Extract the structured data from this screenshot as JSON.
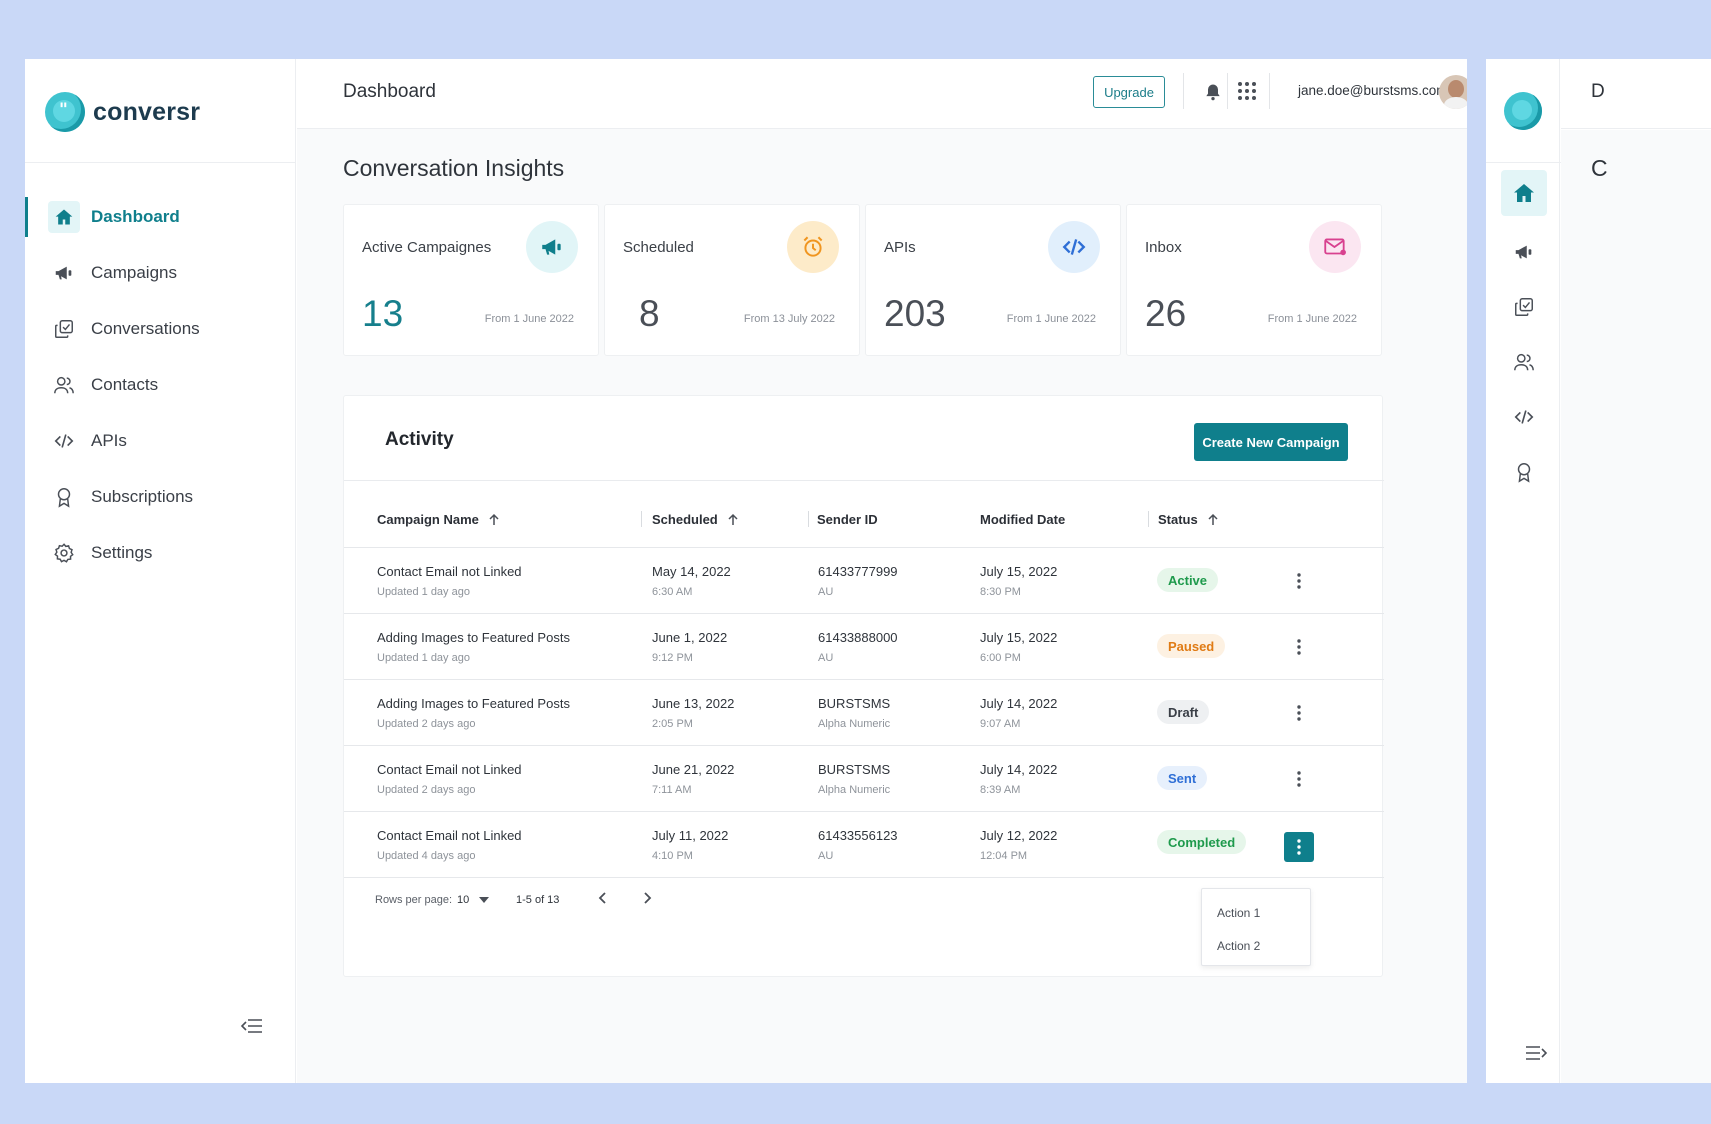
{
  "app": {
    "name": "conversr"
  },
  "header": {
    "title": "Dashboard",
    "upgrade_label": "Upgrade",
    "user_email": "jane.doe@burstsms.com"
  },
  "sidebar": {
    "items": [
      {
        "label": "Dashboard",
        "icon": "home-icon",
        "active": true
      },
      {
        "label": "Campaigns",
        "icon": "megaphone-icon"
      },
      {
        "label": "Conversations",
        "icon": "conversations-icon"
      },
      {
        "label": "Contacts",
        "icon": "contacts-icon"
      },
      {
        "label": "APIs",
        "icon": "code-icon"
      },
      {
        "label": "Subscriptions",
        "icon": "award-icon"
      },
      {
        "label": "Settings",
        "icon": "gear-icon"
      }
    ]
  },
  "insights": {
    "title": "Conversation Insights",
    "cards": [
      {
        "title": "Active Campaignes",
        "value": "13",
        "since": "From 1 June 2022",
        "icon": "megaphone-icon"
      },
      {
        "title": "Scheduled",
        "value": "8",
        "since": "From 13 July 2022",
        "icon": "alarm-clock-icon"
      },
      {
        "title": "APIs",
        "value": "203",
        "since": "From 1 June 2022",
        "icon": "code-icon"
      },
      {
        "title": "Inbox",
        "value": "26",
        "since": "From 1 June 2022",
        "icon": "mail-icon"
      }
    ]
  },
  "activity": {
    "title": "Activity",
    "create_label": "Create New Campaign",
    "columns": [
      "Campaign Name",
      "Scheduled",
      "Sender ID",
      "Modified Date",
      "Status"
    ],
    "rows": [
      {
        "name": "Contact Email not Linked",
        "updated": "Updated 1 day ago",
        "sched_date": "May 14, 2022",
        "sched_time": "6:30 AM",
        "sender": "61433777999",
        "sender_sub": "AU",
        "mod_date": "July 15, 2022",
        "mod_time": "8:30 PM",
        "status": "Active"
      },
      {
        "name": "Adding Images to Featured Posts",
        "updated": "Updated 1 day ago",
        "sched_date": "June 1, 2022",
        "sched_time": "9:12 PM",
        "sender": "61433888000",
        "sender_sub": "AU",
        "mod_date": "July 15, 2022",
        "mod_time": "6:00 PM",
        "status": "Paused"
      },
      {
        "name": "Adding Images to Featured Posts",
        "updated": "Updated 2 days ago",
        "sched_date": "June 13, 2022",
        "sched_time": "2:05 PM",
        "sender": "BURSTSMS",
        "sender_sub": "Alpha Numeric",
        "mod_date": "July 14, 2022",
        "mod_time": "9:07 AM",
        "status": "Draft"
      },
      {
        "name": "Contact Email not Linked",
        "updated": "Updated 2 days ago",
        "sched_date": "June 21, 2022",
        "sched_time": "7:11 AM",
        "sender": "BURSTSMS",
        "sender_sub": "Alpha Numeric",
        "mod_date": "July 14, 2022",
        "mod_time": "8:39 AM",
        "status": "Sent"
      },
      {
        "name": "Contact Email not Linked",
        "updated": "Updated 4 days ago",
        "sched_date": "July 11, 2022",
        "sched_time": "4:10 PM",
        "sender": "61433556123",
        "sender_sub": "AU",
        "mod_date": "July 12, 2022",
        "mod_time": "12:04 PM",
        "status": "Completed"
      }
    ],
    "pagination": {
      "rows_per_page_label": "Rows per page:",
      "rows_per_page": "10",
      "range": "1-5 of 13"
    },
    "menu": {
      "items": [
        "Action 1",
        "Action 2"
      ]
    }
  },
  "second_window": {
    "title_fragment": "D",
    "section_fragment": "C"
  },
  "colors": {
    "accent": "#0f7f8c",
    "page_bg": "#c9d8f7",
    "active": "#1e9a4c",
    "paused": "#e07b14",
    "sent": "#2f6fd6"
  }
}
